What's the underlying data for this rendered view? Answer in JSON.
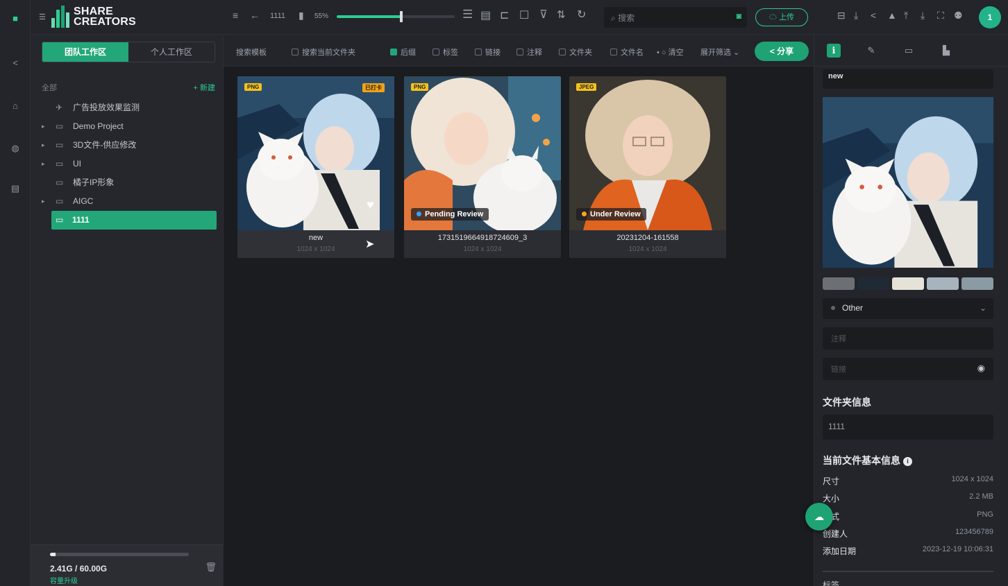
{
  "app": {
    "logo_line1": "SHARE",
    "logo_line2": "CREATORS"
  },
  "toolbar": {
    "breadcrumb": "1111",
    "zoom": "55%",
    "search_placeholder": "搜索",
    "upload_label": "上传",
    "avatar_initial": "1"
  },
  "workspace_tabs": {
    "team": "团队工作区",
    "personal": "个人工作区"
  },
  "tree": {
    "header": "全部",
    "new_label": "+ 新建",
    "items": [
      {
        "label": "广告投放效果监测",
        "arrow": false,
        "icon": "send-icon"
      },
      {
        "label": "Demo Project",
        "arrow": true,
        "icon": "folder-icon"
      },
      {
        "label": "3D文件-供应修改",
        "arrow": true,
        "icon": "folder-icon"
      },
      {
        "label": "UI",
        "arrow": true,
        "icon": "folder-icon"
      },
      {
        "label": "橘子IP形象",
        "arrow": false,
        "icon": "folder-icon"
      },
      {
        "label": "AIGC",
        "arrow": true,
        "icon": "folder-icon"
      },
      {
        "label": "1111",
        "arrow": false,
        "icon": "folder-icon",
        "selected": true
      }
    ]
  },
  "storage": {
    "text": "2.41G / 60.00G",
    "sub": "容量升级",
    "used_fraction": 0.04
  },
  "filters": {
    "search_scope": "搜索模板",
    "current_folder": "搜索当前文件夹",
    "opts": [
      "后缀",
      "标签",
      "链接",
      "注释",
      "文件夹",
      "文件名"
    ],
    "clear": "清空",
    "expand": "展开筛选",
    "share": "分享"
  },
  "cards": [
    {
      "name": "new",
      "dims": "1024 x 1024",
      "format": "PNG",
      "badge2": "已打卡",
      "status": ""
    },
    {
      "name": "1731519664918724609_3",
      "dims": "1024 x 1024",
      "format": "PNG",
      "badge2": "",
      "status": "Pending Review",
      "status_color": "#3aa0ff"
    },
    {
      "name": "20231204-161558",
      "dims": "1024 x 1024",
      "format": "JPEG",
      "badge2": "",
      "status": "Under Review",
      "status_color": "#f5a623"
    }
  ],
  "inspector": {
    "name": "new",
    "swatches": [
      "#6c6f74",
      "#1f2a35",
      "#e5e2d8",
      "#a7b4bd",
      "#8b9aa3"
    ],
    "category": "Other",
    "notes_placeholder": "注释",
    "link_placeholder": "链接",
    "folder_info_title": "文件夹信息",
    "folder_name": "1111",
    "basic_info_title": "当前文件基本信息",
    "rows": [
      {
        "k": "尺寸",
        "v": "1024 x 1024"
      },
      {
        "k": "大小",
        "v": "2.2 MB"
      },
      {
        "k": "格式",
        "v": "PNG"
      },
      {
        "k": "创建人",
        "v": "123456789"
      },
      {
        "k": "添加日期",
        "v": "2023-12-19 10:06:31"
      }
    ],
    "more": "标签"
  }
}
